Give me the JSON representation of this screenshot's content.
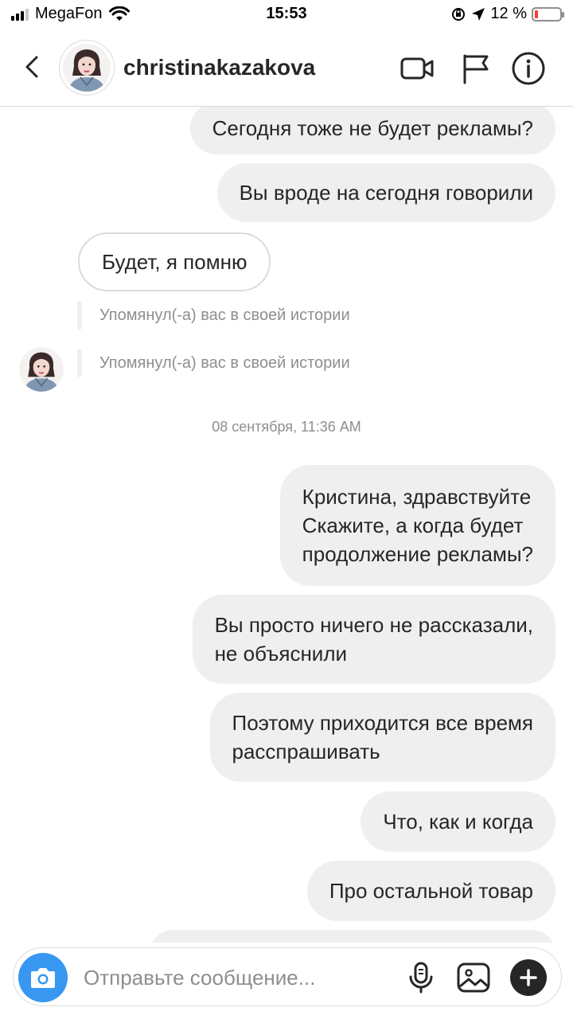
{
  "status_bar": {
    "carrier": "MegaFon",
    "time": "15:53",
    "battery_text": "12 %",
    "battery_level": 0.12,
    "icons": [
      "signal-icon",
      "wifi-icon",
      "orientation-lock-icon",
      "location-arrow-icon",
      "battery-icon"
    ]
  },
  "header": {
    "username": "christinakazakova",
    "icons": [
      "back-chevron-icon",
      "avatar",
      "video-camera-icon",
      "flag-icon",
      "info-icon"
    ]
  },
  "messages": [
    {
      "dir": "out",
      "text": "Сегодня тоже не будет рекламы?"
    },
    {
      "dir": "out",
      "text": "Вы вроде на сегодня говорили"
    },
    {
      "dir": "in",
      "text": "Будет, я помню"
    },
    {
      "dir": "mention",
      "text": "Упомянул(-а) вас в своей истории"
    },
    {
      "dir": "mention",
      "text": "Упомянул(-а) вас в своей истории"
    },
    {
      "dir": "time",
      "text": "08 сентября, 11:36 AM"
    },
    {
      "dir": "out",
      "lines": [
        "Кристина, здравствуйте",
        "Скажите, а когда будет",
        "продолжение рекламы?"
      ]
    },
    {
      "dir": "out",
      "lines": [
        "Вы просто ничего не рассказали,",
        "не объяснили"
      ]
    },
    {
      "dir": "out",
      "lines": [
        "Поэтому приходится все время",
        "расспрашивать"
      ]
    },
    {
      "dir": "out",
      "text": "Что, как и когда"
    },
    {
      "dir": "out",
      "text": "Про остальной товар"
    }
  ],
  "composer": {
    "placeholder": "Отправьте сообщение...",
    "icons": [
      "camera-icon",
      "microphone-icon",
      "gallery-icon",
      "plus-icon"
    ]
  },
  "colors": {
    "accent": "#3897f0",
    "bubble_out": "#efefef",
    "text": "#262626",
    "muted": "#8e8e8e",
    "battery_low": "#ff3b30"
  }
}
